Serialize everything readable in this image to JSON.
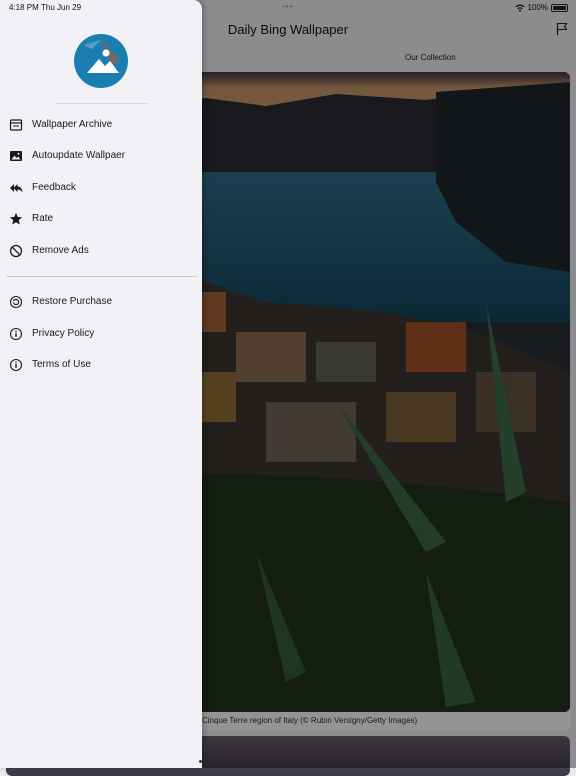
{
  "status": {
    "time": "4:18 PM",
    "date": "Thu Jun 29",
    "battery": "100%"
  },
  "app": {
    "title": "Daily Bing Wallpaper",
    "tab_label": "Our Collection",
    "caption": "Cinque Terre region of Italy (© Rubin Versigny/Getty Images)"
  },
  "drawer": {
    "logo_icon": "mountain-photo-icon",
    "primary_items": [
      {
        "label": "Wallpaper Archive",
        "icon": "archive-icon"
      },
      {
        "label": "Autoupdate Wallpaer",
        "icon": "image-icon"
      },
      {
        "label": "Feedback",
        "icon": "reply-all-icon"
      },
      {
        "label": "Rate",
        "icon": "star-icon"
      },
      {
        "label": "Remove Ads",
        "icon": "block-icon"
      }
    ],
    "secondary_items": [
      {
        "label": "Restore Purchase",
        "icon": "restore-icon"
      },
      {
        "label": "Privacy Policy",
        "icon": "info-icon"
      },
      {
        "label": "Terms of Use",
        "icon": "info-icon"
      }
    ]
  },
  "colors": {
    "logo_blue": "#1a7fb0",
    "drawer_bg": "#f1f1f6",
    "overlay": "rgba(0,0,0,0.42)"
  }
}
